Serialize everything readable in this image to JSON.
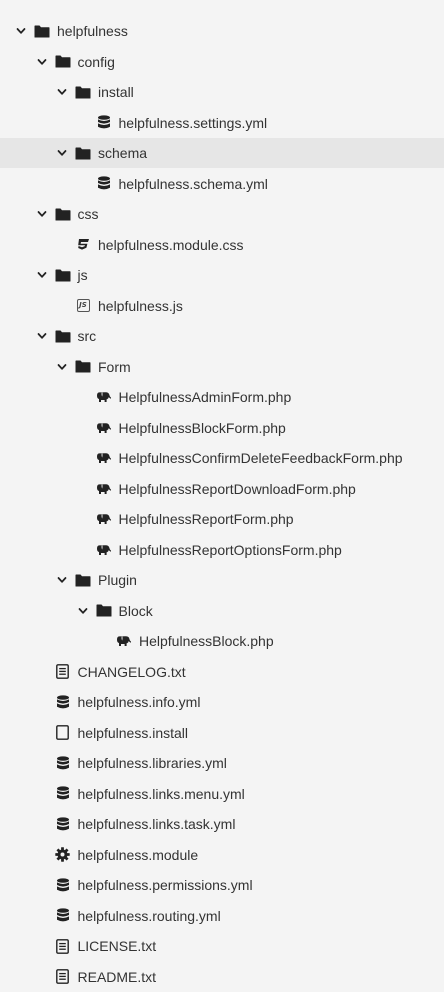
{
  "tree": {
    "items": [
      {
        "label": "helpfulness",
        "type": "folder",
        "depth": 0,
        "expanded": true,
        "icon": "folder-icon"
      },
      {
        "label": "config",
        "type": "folder",
        "depth": 1,
        "expanded": true,
        "icon": "folder-icon"
      },
      {
        "label": "install",
        "type": "folder",
        "depth": 2,
        "expanded": true,
        "icon": "folder-icon"
      },
      {
        "label": "helpfulness.settings.yml",
        "type": "file",
        "depth": 3,
        "icon": "database-icon"
      },
      {
        "label": "schema",
        "type": "folder",
        "depth": 2,
        "expanded": true,
        "selected": true,
        "icon": "folder-icon"
      },
      {
        "label": "helpfulness.schema.yml",
        "type": "file",
        "depth": 3,
        "icon": "database-icon"
      },
      {
        "label": "css",
        "type": "folder",
        "depth": 1,
        "expanded": true,
        "icon": "folder-icon"
      },
      {
        "label": "helpfulness.module.css",
        "type": "file",
        "depth": 2,
        "icon": "css3-icon"
      },
      {
        "label": "js",
        "type": "folder",
        "depth": 1,
        "expanded": true,
        "icon": "folder-icon"
      },
      {
        "label": "helpfulness.js",
        "type": "file",
        "depth": 2,
        "icon": "javascript-icon"
      },
      {
        "label": "src",
        "type": "folder",
        "depth": 1,
        "expanded": true,
        "icon": "folder-icon"
      },
      {
        "label": "Form",
        "type": "folder",
        "depth": 2,
        "expanded": true,
        "icon": "folder-icon"
      },
      {
        "label": "HelpfulnessAdminForm.php",
        "type": "file",
        "depth": 3,
        "icon": "php-elephant-icon"
      },
      {
        "label": "HelpfulnessBlockForm.php",
        "type": "file",
        "depth": 3,
        "icon": "php-elephant-icon"
      },
      {
        "label": "HelpfulnessConfirmDeleteFeedbackForm.php",
        "type": "file",
        "depth": 3,
        "icon": "php-elephant-icon"
      },
      {
        "label": "HelpfulnessReportDownloadForm.php",
        "type": "file",
        "depth": 3,
        "icon": "php-elephant-icon"
      },
      {
        "label": "HelpfulnessReportForm.php",
        "type": "file",
        "depth": 3,
        "icon": "php-elephant-icon"
      },
      {
        "label": "HelpfulnessReportOptionsForm.php",
        "type": "file",
        "depth": 3,
        "icon": "php-elephant-icon"
      },
      {
        "label": "Plugin",
        "type": "folder",
        "depth": 2,
        "expanded": true,
        "icon": "folder-icon"
      },
      {
        "label": "Block",
        "type": "folder",
        "depth": 3,
        "expanded": true,
        "icon": "folder-icon"
      },
      {
        "label": "HelpfulnessBlock.php",
        "type": "file",
        "depth": 4,
        "icon": "php-elephant-icon"
      },
      {
        "label": "CHANGELOG.txt",
        "type": "file",
        "depth": 1,
        "icon": "text-file-icon"
      },
      {
        "label": "helpfulness.info.yml",
        "type": "file",
        "depth": 1,
        "icon": "database-icon"
      },
      {
        "label": "helpfulness.install",
        "type": "file",
        "depth": 1,
        "icon": "blank-file-icon"
      },
      {
        "label": "helpfulness.libraries.yml",
        "type": "file",
        "depth": 1,
        "icon": "database-icon"
      },
      {
        "label": "helpfulness.links.menu.yml",
        "type": "file",
        "depth": 1,
        "icon": "database-icon"
      },
      {
        "label": "helpfulness.links.task.yml",
        "type": "file",
        "depth": 1,
        "icon": "database-icon"
      },
      {
        "label": "helpfulness.module",
        "type": "file",
        "depth": 1,
        "icon": "gear-icon"
      },
      {
        "label": "helpfulness.permissions.yml",
        "type": "file",
        "depth": 1,
        "icon": "database-icon"
      },
      {
        "label": "helpfulness.routing.yml",
        "type": "file",
        "depth": 1,
        "icon": "database-icon"
      },
      {
        "label": "LICENSE.txt",
        "type": "file",
        "depth": 1,
        "icon": "text-file-icon"
      },
      {
        "label": "README.txt",
        "type": "file",
        "depth": 1,
        "icon": "text-file-icon"
      }
    ]
  },
  "colors": {
    "background": "#f4f4f4",
    "selected": "#e6e6e6",
    "text": "#333333",
    "icon": "#222222"
  },
  "icons": {
    "chevron": "chevron-down-icon",
    "folder": "folder-icon",
    "database": "database-icon",
    "css3": "css3-icon",
    "javascript": "javascript-icon",
    "php": "php-elephant-icon",
    "text": "text-file-icon",
    "blank": "blank-file-icon",
    "gear": "gear-icon"
  }
}
